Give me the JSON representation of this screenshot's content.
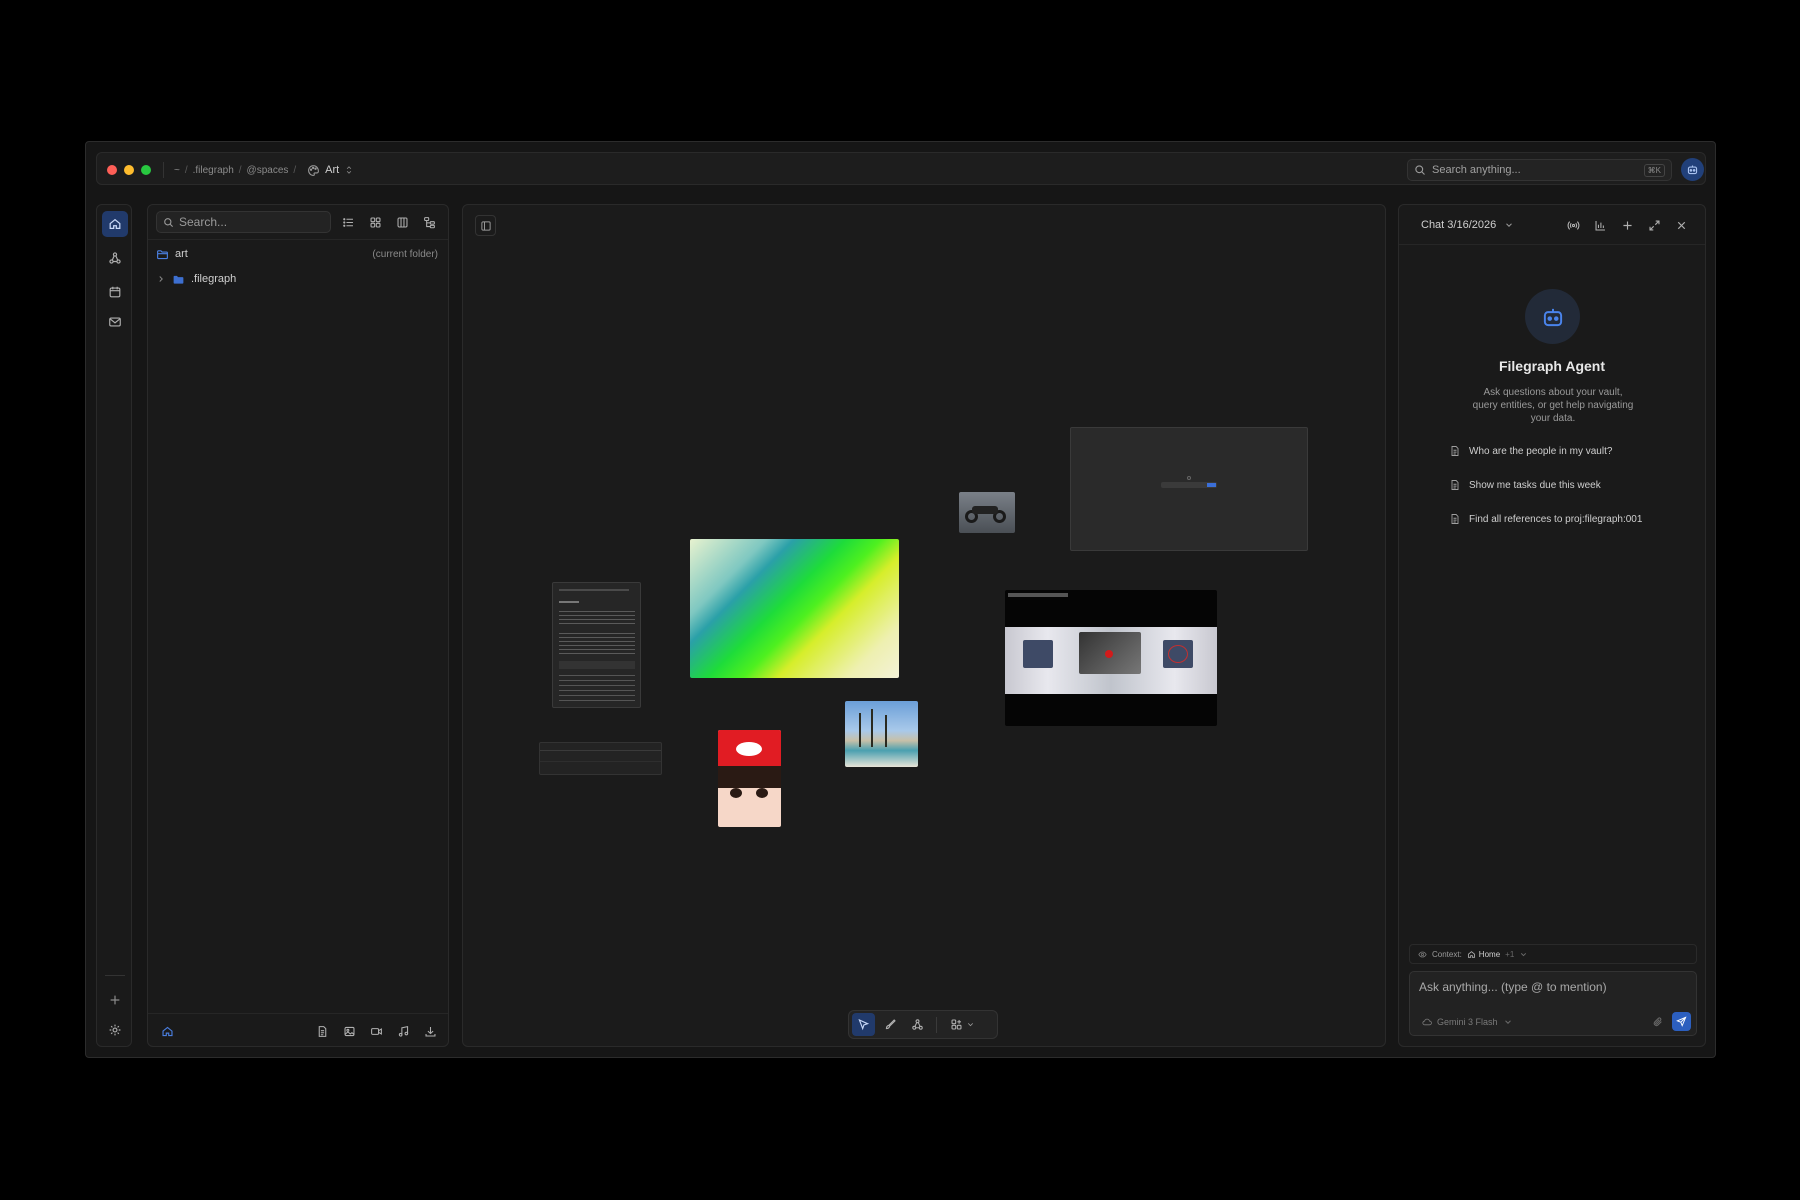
{
  "titlebar": {
    "breadcrumb": [
      "~",
      ".filegraph",
      "@spaces"
    ],
    "space_name": "Art",
    "search_placeholder": "Search anything...",
    "search_shortcut": "⌘K"
  },
  "explorer": {
    "search_placeholder": "Search...",
    "tree": [
      {
        "name": "art",
        "note": "(current folder)"
      },
      {
        "name": ".filegraph",
        "note": ""
      }
    ]
  },
  "chat": {
    "title": "Chat 3/16/2026",
    "agent_name": "Filegraph Agent",
    "agent_description": "Ask questions about your vault, query entities, or get help navigating your data.",
    "suggestions": [
      "Who are the people in my vault?",
      "Show me tasks due this week",
      "Find all references to proj:filegraph:001"
    ],
    "context_label": "Context:",
    "context_item": "Home",
    "context_extra": "+1",
    "input_placeholder": "Ask anything... (type @ to mention)",
    "model": "Gemini 3 Flash"
  },
  "colors": {
    "accent": "#2c5fbf",
    "active_bg": "#213a6b",
    "panel_bg": "#1a1a1a",
    "canvas_bg": "#1b1b1b"
  },
  "icons": {
    "activity": [
      "home-icon",
      "graph-icon",
      "calendar-icon",
      "mail-icon",
      "plus-icon",
      "gear-icon"
    ],
    "explorer_views": [
      "list-view-icon",
      "grid-view-icon",
      "columns-view-icon",
      "tree-view-icon"
    ],
    "explorer_footer": [
      "home-icon",
      "new-note-icon",
      "image-icon",
      "video-icon",
      "music-icon",
      "download-icon"
    ],
    "canvas_tools": [
      "pointer-icon",
      "brush-icon",
      "graph-icon",
      "widgets-icon"
    ]
  }
}
